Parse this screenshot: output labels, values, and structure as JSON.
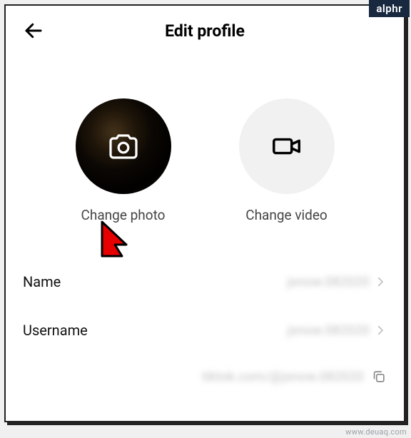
{
  "badge": "alphr",
  "header": {
    "title": "Edit profile"
  },
  "media": {
    "photo_label": "Change photo",
    "video_label": "Change video"
  },
  "rows": {
    "name_label": "Name",
    "name_value": "jsnow.082020",
    "username_label": "Username",
    "username_value": "jsnow.082020"
  },
  "link": {
    "url_text": "tiktok.com/@jsnow.082020"
  },
  "watermark": "www.deuaq.com"
}
